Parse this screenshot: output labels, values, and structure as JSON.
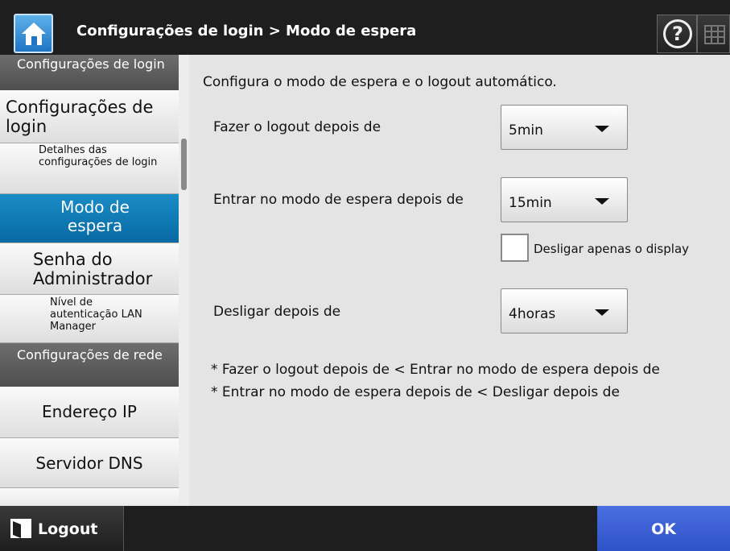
{
  "header": {
    "title": "Configurações de login > Modo de espera",
    "help_glyph": "?",
    "icons": [
      "home-icon",
      "help-icon",
      "keyboard-icon"
    ]
  },
  "sidebar": {
    "section_login": "Configurações de login",
    "item_login_settings": "Configurações de login",
    "item_login_details": "Detalhes das configurações de login",
    "item_standby_mode": "Modo de espera",
    "item_admin_password": "Senha do Administrador",
    "item_lan_manager": "Nível de autenticação LAN Manager",
    "section_network": "Configurações de rede",
    "item_ip_address": "Endereço IP",
    "item_dns_server": "Servidor DNS",
    "selected": "Modo de espera"
  },
  "main": {
    "description": "Configura o modo de espera e o logout automático.",
    "logout_after_label": "Fazer o logout depois de",
    "logout_after_value": "5min",
    "standby_after_label": "Entrar no modo de espera depois de",
    "standby_after_value": "15min",
    "display_only_label": "Desligar apenas o display",
    "display_only_checked": false,
    "power_off_after_label": "Desligar depois de",
    "power_off_after_value": "4horas",
    "note1": "* Fazer o logout depois de < Entrar no modo de espera depois de",
    "note2": "* Entrar no modo de espera depois de < Desligar depois de"
  },
  "footer": {
    "logout_label": "Logout",
    "ok_label": "OK"
  },
  "colors": {
    "selected_item": "#0a77b4",
    "ok_button": "#3a5fd6",
    "section_header": "#5a5a5a",
    "header_bg": "#1e1e1e"
  }
}
